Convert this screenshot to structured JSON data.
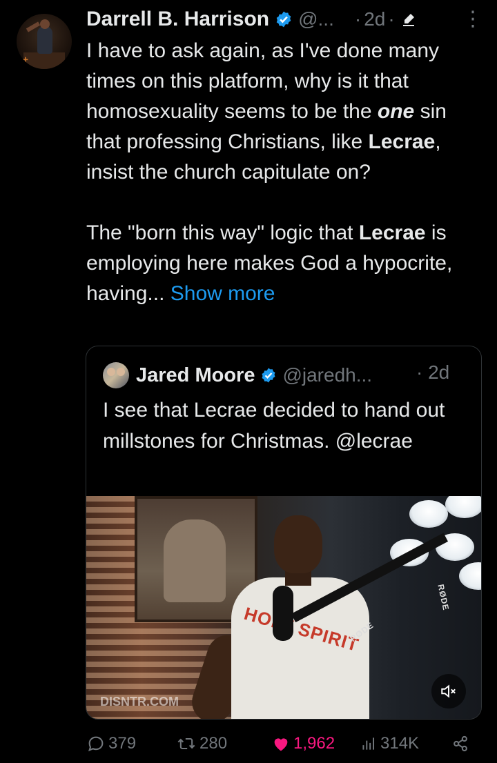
{
  "tweet": {
    "author_name": "Darrell B. Harrison",
    "handle": "@...",
    "time": "2d",
    "body": {
      "p1_a": "I have to ask again, as I've done many times on this platform, why is it that homosexuality seems to be the ",
      "p1_em": "one",
      "p1_b": " sin that professing Christians, like ",
      "p1_bold": "Lecrae",
      "p1_c": ", insist the church capitulate on?",
      "p2_a": "The \"born this way\" logic that ",
      "p2_bold": "Lecrae",
      "p2_b": " is employing here makes God a hypocrite, having... ",
      "show_more": "Show more"
    },
    "stats": {
      "replies": "379",
      "reposts": "280",
      "likes": "1,962",
      "views": "314K"
    }
  },
  "quote": {
    "author_name": "Jared Moore",
    "handle": "@jaredh...",
    "time": "· 2d",
    "text": "I see that Lecrae decided to hand out millstones for Christmas. @lecrae",
    "video": {
      "watermark": "DISNTR.COM",
      "shirt_text": "HOLY SPIRIT",
      "mic_brand": "RØDE"
    }
  },
  "colors": {
    "accent": "#1d9bf0",
    "like": "#f91880",
    "muted": "#71767b",
    "text": "#e7e9ea"
  },
  "icons": [
    "verified-badge-icon",
    "edit-icon",
    "more-icon",
    "mute-icon",
    "reply-icon",
    "repost-icon",
    "like-icon",
    "views-icon",
    "share-icon"
  ]
}
